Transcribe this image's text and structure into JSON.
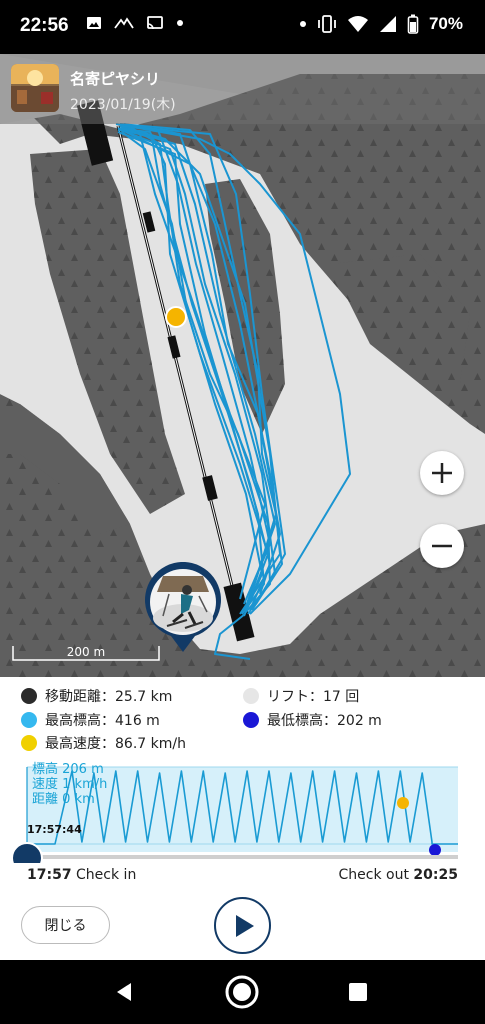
{
  "status_bar": {
    "time": "22:56",
    "battery": "70%",
    "left_icons": [
      "image-icon",
      "mountain-icon",
      "cast-icon",
      "dot-icon"
    ],
    "right_icons": [
      "dot-icon",
      "vibrate-icon",
      "wifi-icon",
      "signal-icon",
      "battery-icon"
    ]
  },
  "header": {
    "place_name": "名寄ピヤシリ",
    "date": "2023/01/19(木)"
  },
  "map": {
    "scale_label": "200 m",
    "zoom_in_icon": "plus-icon",
    "zoom_out_icon": "minus-icon",
    "track_color": "#1b95d1",
    "marker_color": "#f5b400",
    "lift_color": "#111111"
  },
  "stats": {
    "distance": {
      "label": "移動距離：25.7 km",
      "color": "#2b2b2b"
    },
    "lifts": {
      "label": "リフト：17 回",
      "color": "#e6e6e6"
    },
    "max_altitude": {
      "label": "最高標高：416 m",
      "color": "#35b8ef"
    },
    "min_altitude": {
      "label": "最低標高：202 m",
      "color": "#1a17d6"
    },
    "max_speed": {
      "label": "最高速度：86.7 km/h",
      "color": "#f0d000"
    }
  },
  "timeline": {
    "readout": [
      "標高 206 m",
      "速度 1 km/h",
      "距離 0 km"
    ],
    "cursor_time": "17:57:44",
    "check_in_time": "17:57",
    "check_in_label": "Check in",
    "check_out_label": "Check out",
    "check_out_time": "20:25",
    "peaks": 17,
    "line_color": "#1a9bd3",
    "fill_color": "#d6f0fa"
  },
  "actions": {
    "close_label": "閉じる",
    "play_icon": "play-icon"
  },
  "nav": {
    "back_icon": "back-icon",
    "home_icon": "home-icon",
    "recents_icon": "recents-icon"
  }
}
